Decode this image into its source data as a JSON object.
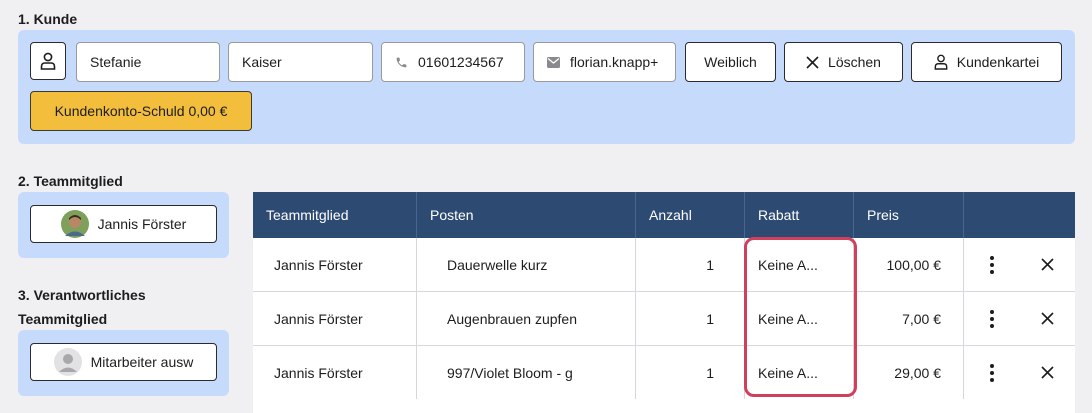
{
  "sections": {
    "kunde": "1. Kunde",
    "teammitglied": "2. Teammitglied",
    "verantwortlich_line1": "3. Verantwortliches",
    "verantwortlich_line2": "Teammitglied"
  },
  "customer": {
    "first_name": "Stefanie",
    "last_name": "Kaiser",
    "phone": "01601234567",
    "email": "florian.knapp+",
    "gender_label": "Weiblich",
    "delete_label": "Löschen",
    "card_label": "Kundenkartei",
    "debt_label": "Kundenkonto-Schuld 0,00 €"
  },
  "team_member": {
    "name": "Jannis Förster"
  },
  "responsible": {
    "placeholder": "Mitarbeiter ausw"
  },
  "table": {
    "headers": [
      "Teammitglied",
      "Posten",
      "Anzahl",
      "Rabatt",
      "Preis",
      ""
    ],
    "rows": [
      {
        "member": "Jannis Förster",
        "item": "Dauerwelle kurz",
        "qty": "1",
        "discount": "Keine A...",
        "price": "100,00 €"
      },
      {
        "member": "Jannis Förster",
        "item": "Augenbrauen zupfen",
        "qty": "1",
        "discount": "Keine A...",
        "price": "7,00 €"
      },
      {
        "member": "Jannis Förster",
        "item": "997/Violet Bloom - g",
        "qty": "1",
        "discount": "Keine A...",
        "price": "29,00 €"
      }
    ]
  },
  "colors": {
    "panel": "#c6dafc",
    "header": "#2c4a72",
    "debt": "#f2be3c",
    "highlight": "#d0405a"
  }
}
